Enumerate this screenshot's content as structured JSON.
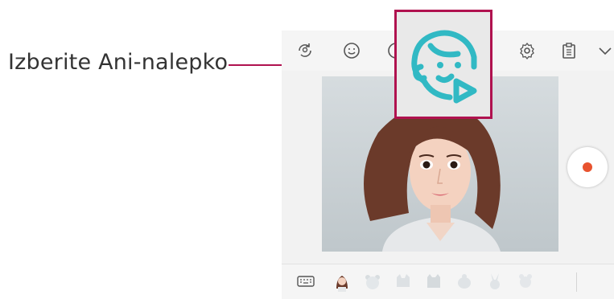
{
  "callout": {
    "label": "Izberite Ani-nalepko",
    "accent_color": "#b0124f"
  },
  "toolbar": {
    "icons": [
      "switch-camera-icon",
      "emoji-icon",
      "ani-sticker-icon",
      "settings-icon",
      "clipboard-icon",
      "chevron-down-icon"
    ]
  },
  "zoom": {
    "icon": "ani-sticker-icon",
    "icon_color": "#31b9c4"
  },
  "camera_preview": {
    "subject": "3D avatar"
  },
  "record_button": {
    "color": "#e8532f"
  },
  "sticker_bar": {
    "items": [
      "keyboard-icon",
      "avatar-sticker",
      "bear-sticker",
      "cat-sticker",
      "cat-sticker-2",
      "bird-sticker",
      "owl-sticker",
      "bunny-sticker",
      "mascot-sticker"
    ]
  }
}
